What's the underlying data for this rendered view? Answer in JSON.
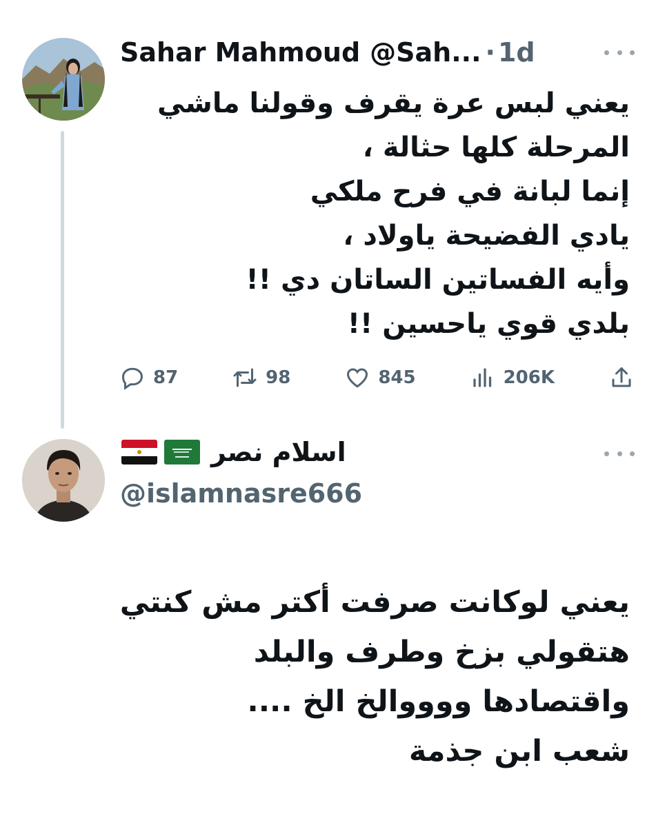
{
  "tweet1": {
    "display_name": "Sahar Mahmoud",
    "handle": "@Sah...",
    "separator": "·",
    "time": "1d",
    "lines": [
      "يعني لبس عرة يقرف وقولنا ماشي",
      "المرحلة كلها حثالة ،",
      "إنما لبانة في فرح ملكي",
      "يادي الفضيحة ياولاد ،",
      "وأيه الفساتين الساتان دي !!",
      "بلدي قوي ياحسين !!"
    ],
    "replies": "87",
    "retweets": "98",
    "likes": "845",
    "views": "206K"
  },
  "tweet2": {
    "display_name": "اسلام نصر",
    "handle": "@islamnasre666",
    "lines": [
      "يعني لوكانت صرفت أكتر مش كنتي",
      "هتقولي بزخ وطرف والبلد",
      "واقتصادها ووووالخ الخ ....",
      "شعب ابن جذمة"
    ]
  },
  "icons": {
    "reply": "reply-icon",
    "retweet": "retweet-icon",
    "like": "heart-icon",
    "views": "views-icon",
    "share": "share-icon",
    "more": "more-icon"
  },
  "colors": {
    "text": "#0f1419",
    "muted": "#536471",
    "thread_line": "#cfd9de"
  }
}
